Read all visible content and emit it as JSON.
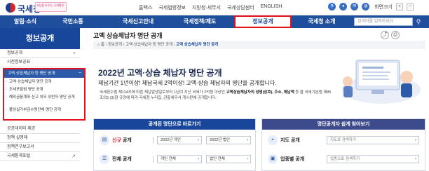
{
  "header": {
    "logo_text": "국세청",
    "slogan": "세상을 바꾸는 국세행정",
    "util_links": [
      "홈택스",
      "국세법령정보",
      "지방청·세무서",
      "국세상담센터",
      "ENGLISH"
    ],
    "zoom_label": "화면크기",
    "zoom_in": "+",
    "zoom_out": "−"
  },
  "nav": {
    "items": [
      "알림·소식",
      "국민소통",
      "국세신고안내",
      "국세정책/제도",
      "정보공개",
      "국세청 소개"
    ],
    "active_index": 4,
    "search_placeholder": "검색어를 입력하세요"
  },
  "sidebar": {
    "title": "정보공개",
    "items_top": [
      "정보공개",
      "사전정보공표"
    ],
    "active": "고액·상습체납자 등 명단 공개",
    "sub_items": [
      "고액·상습체납자 명단 공개",
      "조세포탈범 명단 공개",
      "해외금융계좌 신고 의무 위반자 명단 공개",
      "불성실기부금수령단체 명단 공개"
    ],
    "items_bottom": [
      "공공데이터 제공",
      "정책 실명제",
      "정책연구보고서",
      "국세통계포털"
    ],
    "marks": {
      "plus": "+",
      "minus": "−"
    }
  },
  "content": {
    "title": "고액 상습체납자 명단 공개",
    "breadcrumb": [
      "홈",
      "정보공개",
      "고액·상습체납자 등 명단 공개",
      "고액 상습체납자 명단 공개"
    ],
    "headline": "2022년 고액·상습 체납자 명단 공개",
    "subhead": "체납기간 1년이상! 체납국세 2억이상! 고액·상습 체납자의 명단을 공개합니다.",
    "desc_part1": "국세징수법 제114조에 따른 체납발생일로부터 1년이 지난 국세가 2억원 이상인 ",
    "desc_bold1": "고액상습체납자의 성명(상호), 주소, 체납액",
    "desc_part2": " 등 을 국세기본법 제85조의5 (3)항 규정에 따라 국세청 누리집, 관할세무서 게시판에 공개합니다.",
    "tools": [
      "share-icon",
      "print-icon"
    ]
  },
  "panel_left": {
    "title": "공개된 명단으로 바로가기",
    "rows": [
      {
        "label_red": "신규",
        "label": " 공개",
        "fields": [
          "2022년 개인",
          "2022년 법인"
        ]
      },
      {
        "label_red": "",
        "label": "전체 공개",
        "fields": [
          "개인 전체",
          "법인 전체"
        ]
      }
    ]
  },
  "panel_right": {
    "title": "명단공개자 쉽게 찾아보기",
    "rows": [
      {
        "label": "지도 공개",
        "field": "지도로 검색하기"
      },
      {
        "label": "업종별 공개",
        "field": "업종으로 검색하기"
      }
    ]
  },
  "colors": {
    "nav_bg": "#1f4e9c",
    "highlight_border": "#e0121d",
    "sidebar_head": "#17469b"
  }
}
